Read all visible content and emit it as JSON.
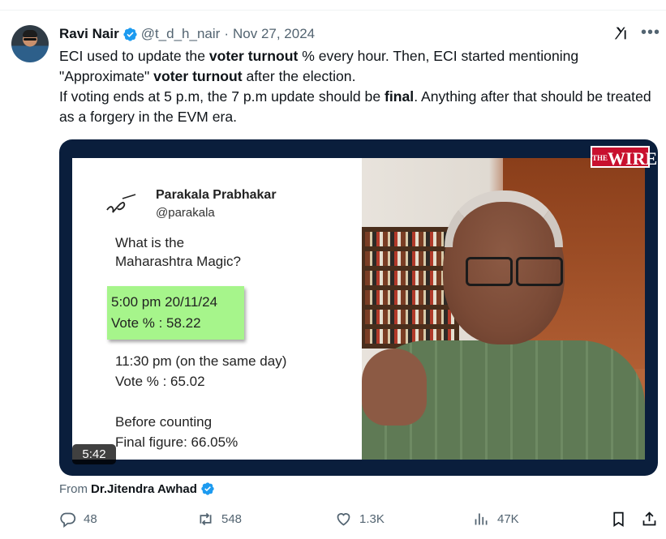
{
  "tweet": {
    "author_name": "Ravi Nair",
    "handle": "@t_d_h_nair",
    "separator": "·",
    "date": "Nov 27, 2024",
    "text": {
      "p1_a": "ECI used to update the ",
      "p1_b": "voter turnout",
      "p1_c": " % every hour. Then, ECI started mentioning \"Approximate\" ",
      "p1_d": "voter turnout",
      "p1_e": " after the election.",
      "p2_a": "If voting ends at 5 p.m, the 7 p.m update should be ",
      "p2_b": "final",
      "p2_c": ". Anything after that should be treated as a forgery in the EVM era."
    }
  },
  "media": {
    "slide": {
      "poster_name": "Parakala Prabhakar",
      "poster_handle": "@parakala",
      "question_line1": "What is the",
      "question_line2": "Maharashtra Magic?",
      "highlight_line1": "5:00 pm 20/11/24",
      "highlight_line2": "Vote % : 58.22",
      "second_line1": "11:30 pm (on the same day)",
      "second_line2": "Vote % : 65.02",
      "third_line1": "Before counting",
      "third_line2": "Final figure: 66.05%"
    },
    "watermark": "WIRE",
    "watermark_prefix": "THE",
    "duration": "5:42"
  },
  "attribution": {
    "prefix": "From",
    "source_name": "Dr.Jitendra Awhad"
  },
  "actions": {
    "replies": "48",
    "reposts": "548",
    "likes": "1.3K",
    "views": "47K"
  },
  "colors": {
    "verified_blue": "#1d9bf0",
    "text_primary": "#0f1419",
    "text_secondary": "#536471",
    "highlight_green": "#a6f58b",
    "wire_red": "#c8102e"
  },
  "icons": [
    "verified-badge-icon",
    "grok-icon",
    "more-icon",
    "reply-icon",
    "repost-icon",
    "like-icon",
    "views-icon",
    "bookmark-icon",
    "share-icon"
  ]
}
